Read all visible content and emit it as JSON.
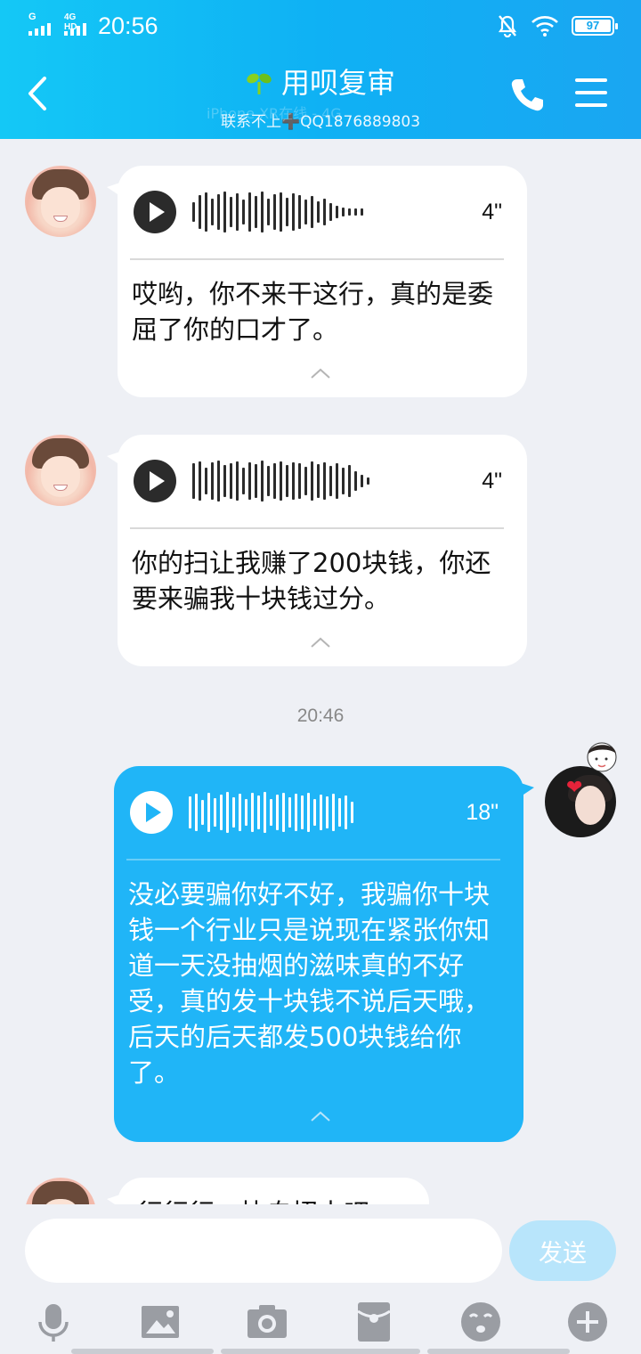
{
  "status_bar": {
    "sim1_tag": "G",
    "sim2_tag": "4G HD",
    "time": "20:56",
    "battery": "97"
  },
  "header": {
    "title": "用呗复审",
    "subtitle": "联系不上➕QQ1876889803",
    "ghost_status": "iPhone XR在线 - 4G"
  },
  "messages": [
    {
      "sender": "contact",
      "voice_duration": "4\"",
      "text": "哎哟，你不来干这行，真的是委屈了你的口才了。"
    },
    {
      "sender": "contact",
      "voice_duration": "4\"",
      "text": "你的扫让我赚了200块钱，你还要来骗我十块钱过分。"
    },
    {
      "sender": "me",
      "voice_duration": "18\"",
      "text": "没必要骗你好不好，我骗你十块钱一个行业只是说现在紧张你知道一天没抽烟的滋味真的不好受，真的发十块钱不说后天哦，后天的后天都发500块钱给你了。"
    },
    {
      "sender": "contact",
      "text": "行行行，快自招去吧"
    }
  ],
  "timestamp": "20:46",
  "composer": {
    "input_value": "",
    "input_placeholder": "",
    "send_label": "发送"
  },
  "toolbar_icons": [
    "microphone-icon",
    "image-icon",
    "camera-icon",
    "red-packet-icon",
    "emoji-icon",
    "plus-icon"
  ],
  "colors": {
    "header": "#14b8f5",
    "my_bubble": "#20b5f7",
    "send_disabled": "#b8e5fb",
    "background": "#eef0f5"
  }
}
